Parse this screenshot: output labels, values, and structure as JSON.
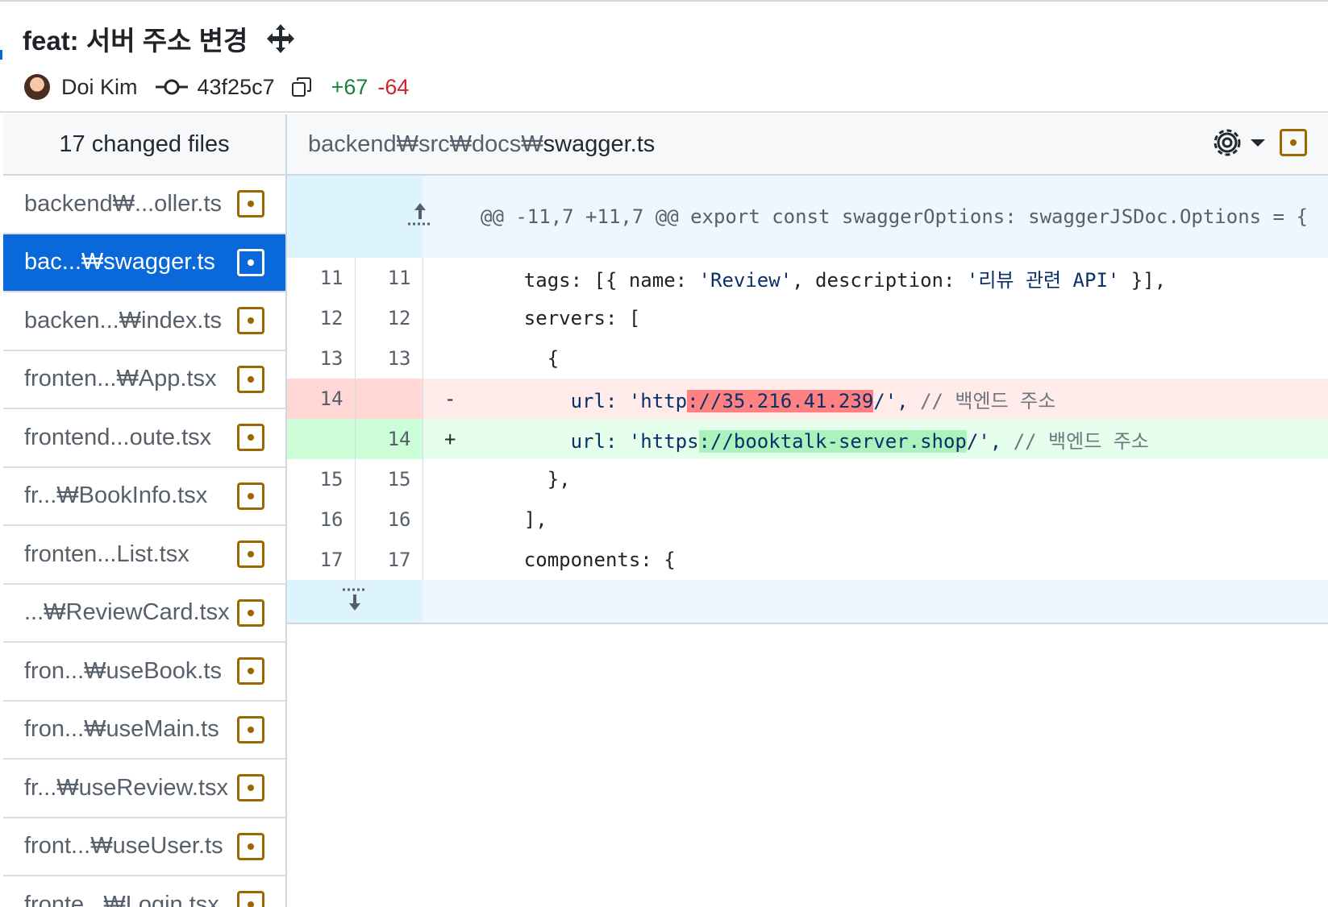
{
  "commit": {
    "title": "feat: 서버 주소 변경",
    "author": "Doi Kim",
    "hash": "43f25c7",
    "additions": "+67",
    "deletions": "-64"
  },
  "sidebar": {
    "header": "17 changed files",
    "files": [
      {
        "label": "backend₩...oller.ts",
        "active": false
      },
      {
        "label": "bac...₩swagger.ts",
        "active": true
      },
      {
        "label": "backen...₩index.ts",
        "active": false
      },
      {
        "label": "fronten...₩App.tsx",
        "active": false
      },
      {
        "label": "frontend...oute.tsx",
        "active": false
      },
      {
        "label": "fr...₩BookInfo.tsx",
        "active": false
      },
      {
        "label": "fronten...List.tsx",
        "active": false
      },
      {
        "label": "...₩ReviewCard.tsx",
        "active": false
      },
      {
        "label": "fron...₩useBook.ts",
        "active": false
      },
      {
        "label": "fron...₩useMain.ts",
        "active": false
      },
      {
        "label": "fr...₩useReview.tsx",
        "active": false
      },
      {
        "label": "front...₩useUser.ts",
        "active": false
      },
      {
        "label": "fronte...₩Login.tsx",
        "active": false
      }
    ]
  },
  "diff": {
    "path_prefix": "backend₩src₩docs₩",
    "path_file": "swagger.ts",
    "hunk_header": "@@ -11,7 +11,7 @@ export const swaggerOptions: swaggerJSDoc.Options = {",
    "lines": [
      {
        "old": "11",
        "new": "11",
        "sign": "",
        "type": "ctx",
        "code": "    tags: [{ name: 'Review', description: '리뷰 관련 API' }],"
      },
      {
        "old": "12",
        "new": "12",
        "sign": "",
        "type": "ctx",
        "code": "    servers: ["
      },
      {
        "old": "13",
        "new": "13",
        "sign": "",
        "type": "ctx",
        "code": "      {"
      },
      {
        "old": "14",
        "new": "",
        "sign": "-",
        "type": "del",
        "pre": "        url: 'http",
        "hl": "://35.216.41.239",
        "post": "/', ",
        "comment": "// 백엔드 주소"
      },
      {
        "old": "",
        "new": "14",
        "sign": "+",
        "type": "add",
        "pre": "        url: 'https",
        "hl": "://booktalk-server.shop",
        "post": "/', ",
        "comment": "// 백엔드 주소"
      },
      {
        "old": "15",
        "new": "15",
        "sign": "",
        "type": "ctx",
        "code": "      },"
      },
      {
        "old": "16",
        "new": "16",
        "sign": "",
        "type": "ctx",
        "code": "    ],"
      },
      {
        "old": "17",
        "new": "17",
        "sign": "",
        "type": "ctx",
        "code": "    components: {"
      }
    ]
  },
  "icons": {
    "move": "move-arrows-icon",
    "commit": "git-commit-icon",
    "copy": "copy-icon",
    "settings": "gear-icon",
    "expand_up": "expand-up-icon",
    "expand_down": "expand-down-icon",
    "file_modified": "file-modified-icon"
  },
  "colors": {
    "accent": "#0969da",
    "added": "#1a7f37",
    "removed": "#cf222e",
    "modified_badge": "#9a6700"
  }
}
